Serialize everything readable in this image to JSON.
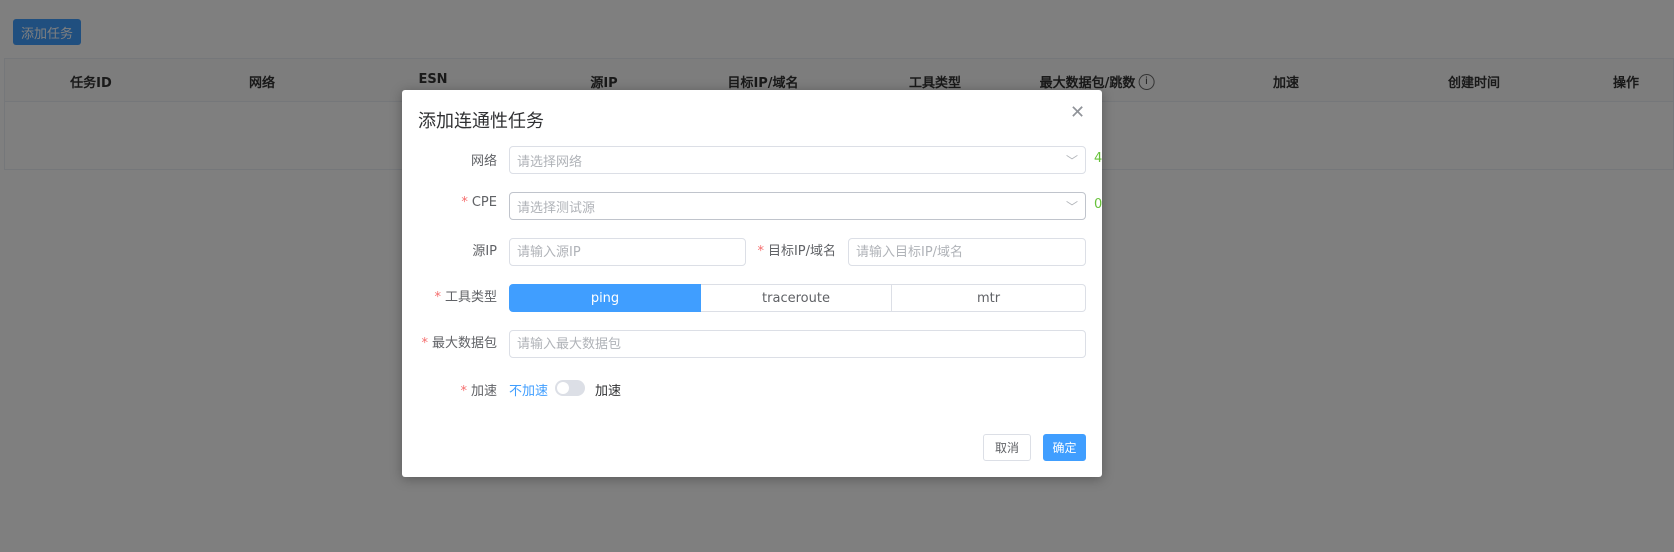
{
  "toolbar": {
    "add_task": "添加任务"
  },
  "table": {
    "columns": [
      "任务ID",
      "网络",
      "ESN",
      "源IP",
      "目标IP/域名",
      "工具类型",
      "最大数据包/跳数",
      "加速",
      "创建时间",
      "操作"
    ]
  },
  "dialog": {
    "title": "添加连通性任务",
    "network": {
      "label": "网络",
      "placeholder": "请选择网络",
      "count": "4"
    },
    "cpe": {
      "label": "CPE",
      "placeholder": "请选择测试源",
      "count": "0"
    },
    "source_ip": {
      "label": "源IP",
      "placeholder": "请输入源IP"
    },
    "target": {
      "label": "目标IP/域名",
      "placeholder": "请输入目标IP/域名"
    },
    "tool": {
      "label": "工具类型",
      "options": [
        "ping",
        "traceroute",
        "mtr"
      ],
      "selected": "ping"
    },
    "max_packets": {
      "label": "最大数据包",
      "placeholder": "请输入最大数据包"
    },
    "accel": {
      "label": "加速",
      "off_label": "不加速",
      "on_label": "加速",
      "enabled": false
    },
    "cancel": "取消",
    "confirm": "确定",
    "required_mark": "*",
    "accent": "#409eff"
  }
}
